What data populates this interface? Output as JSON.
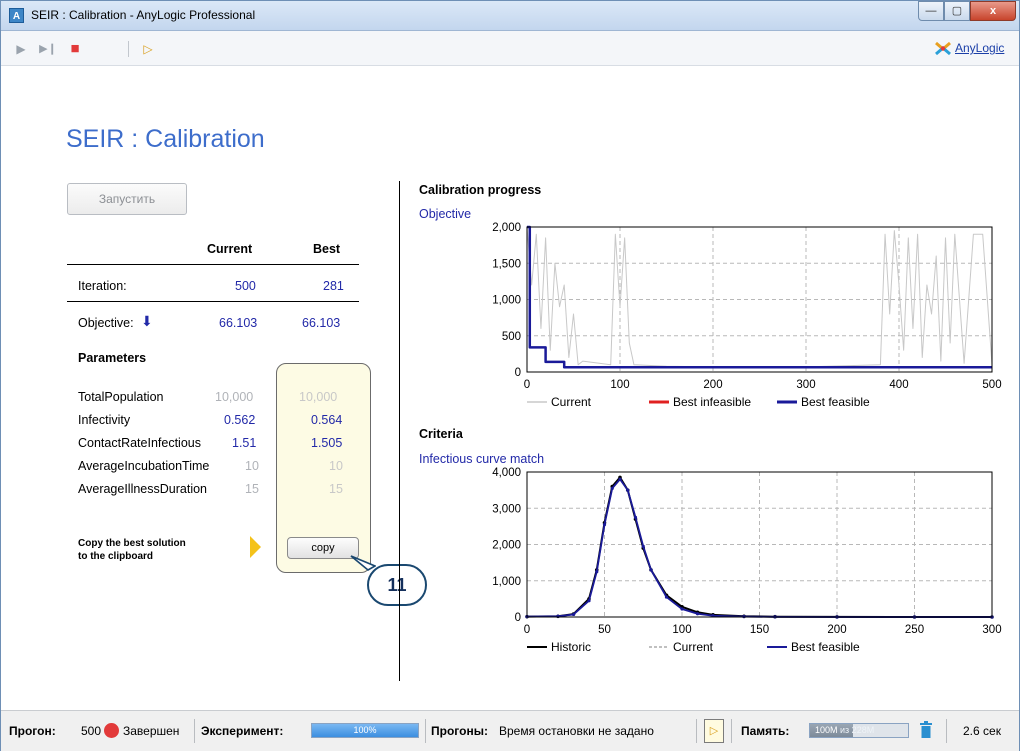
{
  "window": {
    "title": "SEIR : Calibration - AnyLogic Professional",
    "app_icon_letter": "A",
    "minimize": "—",
    "maximize": "▢",
    "close": "x"
  },
  "toolbar": {
    "play": "▶",
    "step": "▶❙",
    "stop": "■",
    "experiment": "▷",
    "brand": "AnyLogic"
  },
  "page": {
    "title": "SEIR : Calibration",
    "run_button": "Запустить"
  },
  "table": {
    "col_current": "Current",
    "col_best": "Best",
    "iteration_label": "Iteration:",
    "iteration_current": "500",
    "iteration_best": "281",
    "objective_label": "Objective:",
    "objective_arrow": "⬇",
    "objective_current": "66.103",
    "objective_best": "66.103"
  },
  "parameters": {
    "heading": "Parameters",
    "rows": [
      {
        "name": "TotalPopulation",
        "current": "10,000",
        "best": "10,000",
        "editable": false
      },
      {
        "name": "Infectivity",
        "current": "0.562",
        "best": "0.564",
        "editable": true
      },
      {
        "name": "ContactRateInfectious",
        "current": "1.51",
        "best": "1.505",
        "editable": true
      },
      {
        "name": "AverageIncubationTime",
        "current": "10",
        "best": "10",
        "editable": false
      },
      {
        "name": "AverageIllnessDuration",
        "current": "15",
        "best": "15",
        "editable": false
      }
    ],
    "copy_text_line1": "Copy the best solution",
    "copy_text_line2": "to the clipboard",
    "copy_button": "copy",
    "callout_number": "11"
  },
  "progress_chart": {
    "heading": "Calibration progress",
    "subtitle": "Objective",
    "legend": [
      "Current",
      "Best infeasible",
      "Best feasible"
    ],
    "colors": {
      "current": "#c8c8c8",
      "best_infeasible": "#e02020",
      "best_feasible": "#1a1a99"
    }
  },
  "criteria_chart": {
    "heading": "Criteria",
    "subtitle": "Infectious curve match",
    "legend": [
      "Historic",
      "Current",
      "Best feasible"
    ],
    "colors": {
      "historic": "#000000",
      "current": "#c0c0c0",
      "best_feasible": "#1a1a99"
    }
  },
  "chart_data": [
    {
      "type": "line",
      "title": "Objective",
      "xlim": [
        0,
        500
      ],
      "ylim": [
        0,
        2000
      ],
      "x_ticks": [
        "0",
        "100",
        "200",
        "300",
        "400",
        "500"
      ],
      "y_ticks": [
        "0",
        "500",
        "1,000",
        "1,500",
        "2,000"
      ],
      "grid": true,
      "legend_position": "bottom",
      "series": [
        {
          "name": "Best feasible",
          "x": [
            0,
            3,
            3,
            20,
            20,
            40,
            40,
            500
          ],
          "y": [
            2000,
            2000,
            340,
            340,
            140,
            140,
            66,
            66
          ]
        },
        {
          "name": "Current",
          "x": [
            0,
            5,
            10,
            15,
            20,
            25,
            30,
            35,
            40,
            45,
            50,
            55,
            60,
            90,
            95,
            100,
            105,
            110,
            115,
            150,
            200,
            300,
            380,
            385,
            390,
            395,
            400,
            405,
            410,
            415,
            420,
            425,
            430,
            435,
            440,
            445,
            450,
            455,
            460,
            470,
            480,
            490,
            500
          ],
          "y": [
            2000,
            1200,
            1900,
            600,
            1850,
            300,
            1500,
            900,
            1200,
            200,
            800,
            100,
            150,
            100,
            1900,
            900,
            1850,
            400,
            100,
            80,
            70,
            70,
            100,
            1900,
            800,
            1950,
            1200,
            300,
            1850,
            600,
            1900,
            200,
            1200,
            800,
            1600,
            150,
            1850,
            400,
            1900,
            120,
            1900,
            1900,
            100
          ]
        }
      ]
    },
    {
      "type": "line",
      "title": "Infectious curve match",
      "xlim": [
        0,
        300
      ],
      "ylim": [
        0,
        4000
      ],
      "x_ticks": [
        "0",
        "50",
        "100",
        "150",
        "200",
        "250",
        "300"
      ],
      "y_ticks": [
        "0",
        "1,000",
        "2,000",
        "3,000",
        "4,000"
      ],
      "grid": true,
      "legend_position": "bottom",
      "series": [
        {
          "name": "Historic",
          "x": [
            0,
            20,
            30,
            40,
            45,
            50,
            55,
            60,
            65,
            70,
            75,
            80,
            90,
            100,
            110,
            120,
            140,
            160,
            200,
            250,
            300
          ],
          "y": [
            10,
            20,
            80,
            500,
            1300,
            2600,
            3600,
            3850,
            3500,
            2700,
            1900,
            1300,
            600,
            280,
            130,
            60,
            20,
            8,
            2,
            0,
            0
          ]
        },
        {
          "name": "Current",
          "x": [
            0,
            20,
            30,
            40,
            45,
            50,
            55,
            60,
            65,
            70,
            75,
            80,
            90,
            100,
            110,
            120,
            140,
            160,
            200,
            250,
            300
          ],
          "y": [
            10,
            20,
            70,
            450,
            1250,
            2550,
            3550,
            3800,
            3500,
            2750,
            1950,
            1300,
            550,
            220,
            90,
            35,
            10,
            3,
            0,
            0,
            0
          ]
        },
        {
          "name": "Best feasible",
          "x": [
            0,
            20,
            30,
            40,
            45,
            50,
            55,
            60,
            65,
            70,
            75,
            80,
            90,
            100,
            110,
            120,
            140,
            160,
            200,
            250,
            300
          ],
          "y": [
            10,
            20,
            70,
            450,
            1250,
            2550,
            3550,
            3800,
            3500,
            2750,
            1950,
            1300,
            550,
            220,
            90,
            35,
            10,
            3,
            0,
            0,
            0
          ]
        }
      ]
    }
  ],
  "status": {
    "runs_label": "Прогон:",
    "runs_value": "500",
    "state": "Завершен",
    "experiment_label": "Эксперимент:",
    "experiment_progress": "100%",
    "experiment_fraction": 1.0,
    "runs_info_label": "Прогоны:",
    "runs_info_value": "Время остановки не задано",
    "memory_label": "Память:",
    "memory_used": "100M",
    "memory_total": "из 228M",
    "memory_fraction": 0.44,
    "time": "2.6 сек"
  }
}
